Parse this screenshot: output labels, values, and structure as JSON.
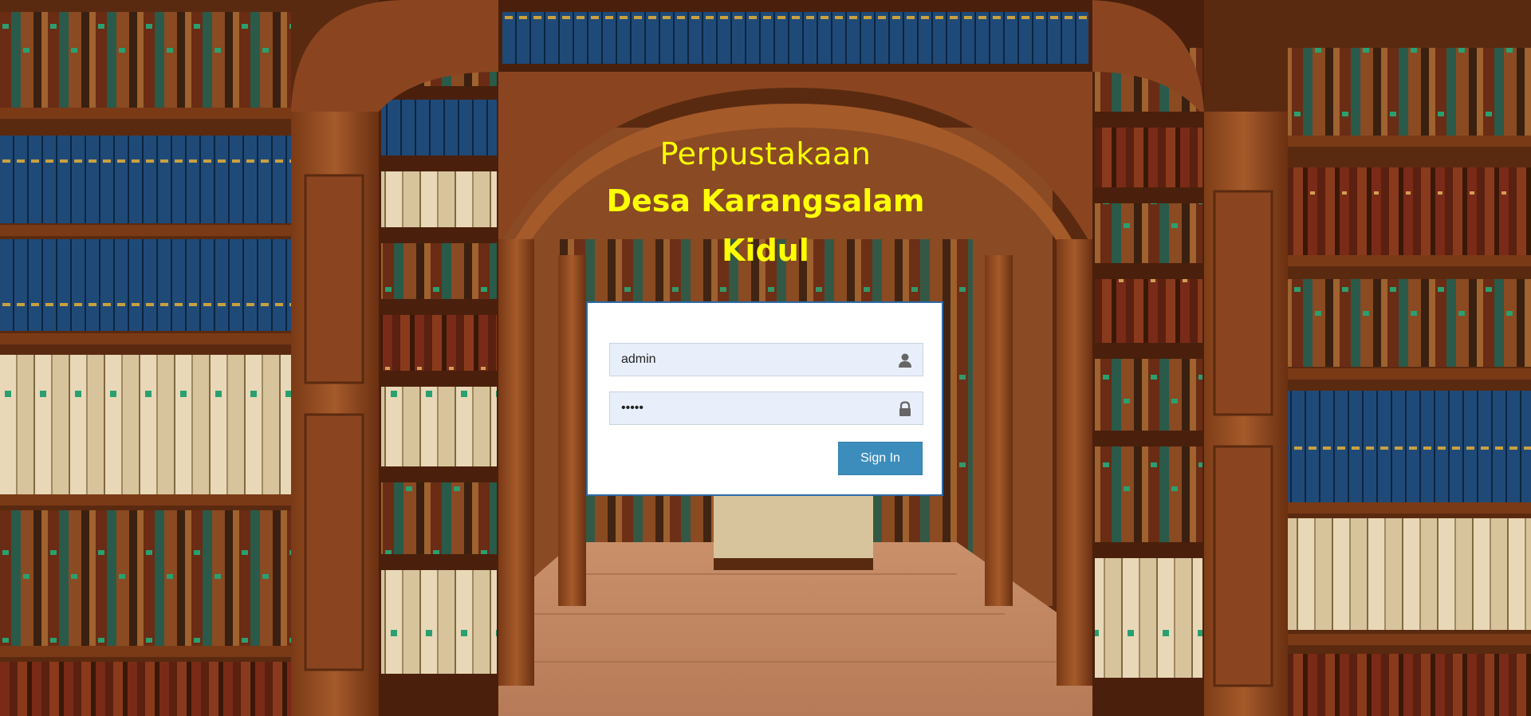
{
  "header": {
    "line1": "Perpustakaan",
    "line2": "Desa Karangsalam",
    "line3": "Kidul",
    "color": "#ffff00"
  },
  "login": {
    "username_value": "admin",
    "password_value": "•••••",
    "username_icon": "user-icon",
    "password_icon": "lock-icon",
    "submit_label": "Sign In",
    "accent": "#3c8dbc",
    "border": "#2c6aa8"
  },
  "background": {
    "description_icon": "library-bookshelves-background"
  }
}
